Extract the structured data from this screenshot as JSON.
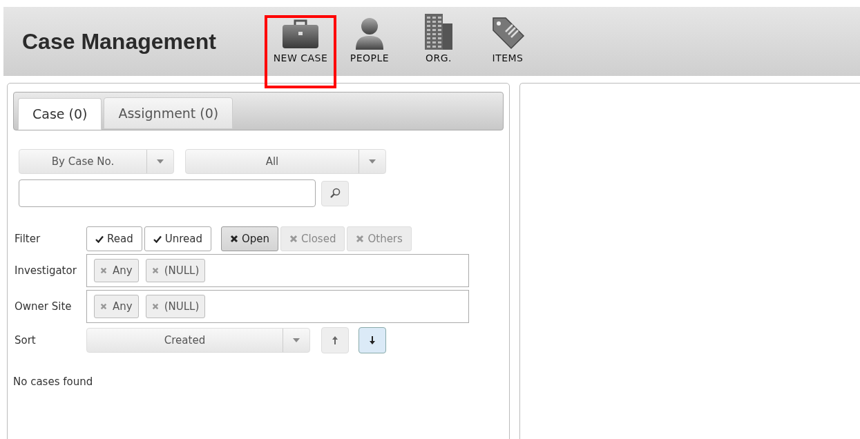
{
  "header": {
    "title": "Case Management"
  },
  "nav": [
    {
      "label": "NEW CASE",
      "kind": "case",
      "highlighted": true
    },
    {
      "label": "PEOPLE",
      "kind": "person",
      "highlighted": false
    },
    {
      "label": "ORG.",
      "kind": "building",
      "highlighted": false
    },
    {
      "label": "ITEMS",
      "kind": "tag",
      "highlighted": false
    }
  ],
  "tabs": [
    {
      "label": "Case (0)",
      "selected": true
    },
    {
      "label": "Assignment (0)",
      "selected": false
    }
  ],
  "search_by": {
    "value": "By Case No."
  },
  "scope": {
    "value": "All"
  },
  "filter": {
    "label": "Filter",
    "toggles": [
      {
        "label": "Read",
        "kind": "check",
        "selected": true
      },
      {
        "label": "Unread",
        "kind": "check",
        "selected": true
      },
      {
        "label": "Open",
        "kind": "status",
        "selected": true
      },
      {
        "label": "Closed",
        "kind": "status",
        "selected": false
      },
      {
        "label": "Others",
        "kind": "status",
        "selected": false
      }
    ]
  },
  "tag_rows": [
    {
      "label": "Investigator",
      "tags": [
        "Any",
        "(NULL)"
      ]
    },
    {
      "label": "Owner Site",
      "tags": [
        "Any",
        "(NULL)"
      ]
    }
  ],
  "sort": {
    "label": "Sort",
    "value": "Created",
    "ascending": {
      "selected": false
    },
    "descending": {
      "selected": true
    }
  },
  "message": "No cases found"
}
